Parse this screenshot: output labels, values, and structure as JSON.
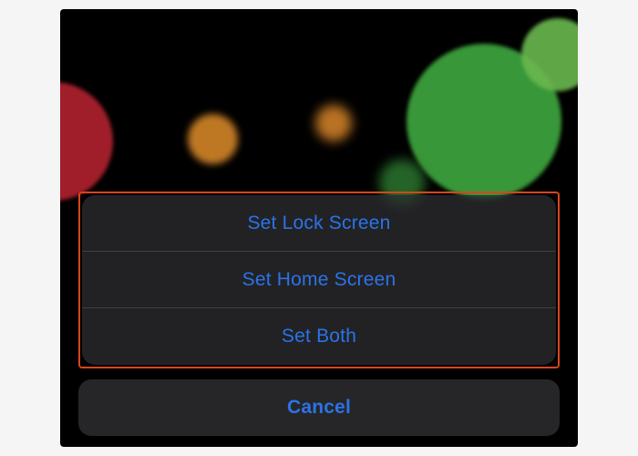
{
  "actionSheet": {
    "options": [
      {
        "label": "Set Lock Screen"
      },
      {
        "label": "Set Home Screen"
      },
      {
        "label": "Set Both"
      }
    ],
    "cancel_label": "Cancel"
  }
}
